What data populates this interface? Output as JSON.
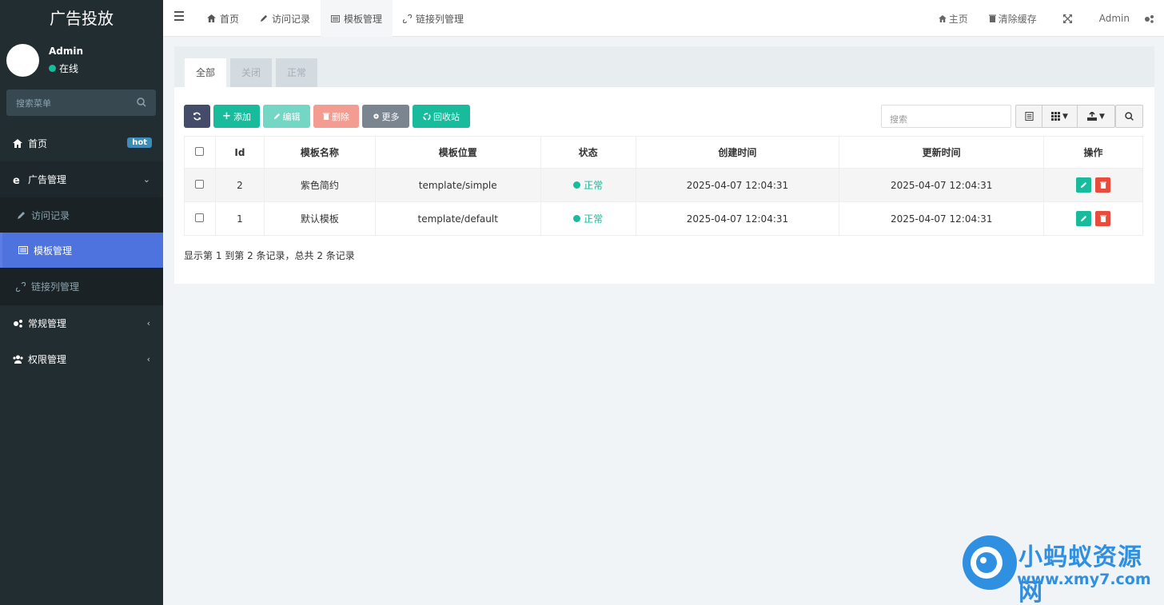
{
  "sidebar": {
    "logo": "广告投放",
    "user": {
      "name": "Admin",
      "status": "在线"
    },
    "search_placeholder": "搜索菜单",
    "items": [
      {
        "label": "首页",
        "badge": "hot"
      },
      {
        "label": "广告管理"
      },
      {
        "label": "访问记录"
      },
      {
        "label": "模板管理"
      },
      {
        "label": "链接列管理"
      },
      {
        "label": "常规管理"
      },
      {
        "label": "权限管理"
      }
    ]
  },
  "header": {
    "tabs": [
      "首页",
      "访问记录",
      "模板管理",
      "链接列管理"
    ],
    "right": {
      "home": "主页",
      "clear_cache": "清除缓存",
      "user": "Admin"
    }
  },
  "panel": {
    "tabs": [
      "全部",
      "关闭",
      "正常"
    ],
    "toolbar": {
      "add": "添加",
      "edit": "编辑",
      "delete": "删除",
      "more": "更多",
      "recycle": "回收站"
    },
    "search_placeholder": "搜索",
    "columns": [
      "Id",
      "模板名称",
      "模板位置",
      "状态",
      "创建时间",
      "更新时间",
      "操作"
    ],
    "rows": [
      {
        "id": "2",
        "name": "紫色简约",
        "path": "template/simple",
        "status": "正常",
        "created": "2025-04-07 12:04:31",
        "updated": "2025-04-07 12:04:31"
      },
      {
        "id": "1",
        "name": "默认模板",
        "path": "template/default",
        "status": "正常",
        "created": "2025-04-07 12:04:31",
        "updated": "2025-04-07 12:04:31"
      }
    ],
    "footer": "显示第 1 到第 2 条记录，总共 2 条记录"
  },
  "watermark": {
    "title": "小蚂蚁资源网",
    "url": "www.xmy7.com"
  },
  "colors": {
    "sidebar": "#222d32",
    "active": "#4e73df",
    "green": "#18bc9c",
    "red": "#e74c3c"
  }
}
